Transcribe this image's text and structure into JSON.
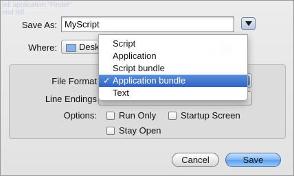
{
  "dialog": {
    "ghost_lines": [
      "tell application \"Finder\"",
      "end tell"
    ],
    "save_as_label": "Save As:",
    "filename": "MyScript",
    "where_label": "Where:",
    "where_value": "Desk",
    "file_format_label": "File Format",
    "line_endings_label": "Line Endings",
    "options_label": "Options:",
    "options": [
      {
        "label": "Run Only",
        "checked": false
      },
      {
        "label": "Startup Screen",
        "checked": false
      },
      {
        "label": "Stay Open",
        "checked": false
      }
    ],
    "cancel_label": "Cancel",
    "save_label": "Save"
  },
  "file_format_menu": {
    "items": [
      "Script",
      "Application",
      "Script bundle",
      "Application bundle",
      "Text"
    ],
    "selected": "Application bundle",
    "checkmark": "✓"
  },
  "colors": {
    "selection": "#2e64c5",
    "save_button": "#5a9de9"
  }
}
